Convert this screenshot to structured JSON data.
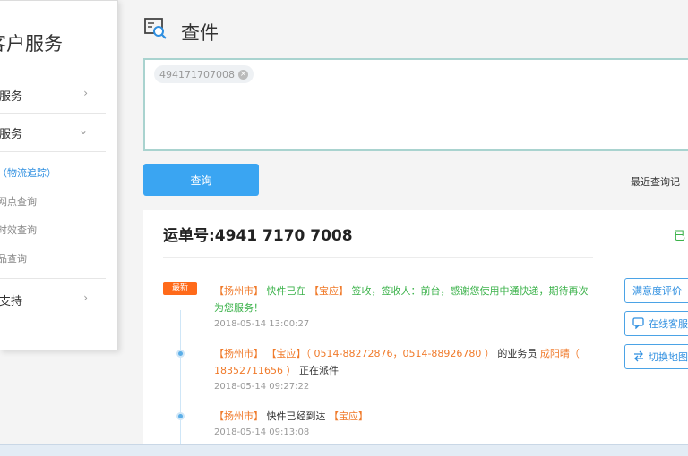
{
  "sidebar": {
    "title": "客户服务",
    "items": [
      {
        "label": "件服务",
        "chevron": "›"
      },
      {
        "label": "询服务",
        "chevron": "⌄"
      }
    ],
    "sub_items": [
      {
        "label": "件（物流追踪）",
        "active": true
      },
      {
        "label": "务网点查询"
      },
      {
        "label": "费时效查询"
      },
      {
        "label": "禁品查询"
      }
    ],
    "support": {
      "label": "服支持",
      "chevron": "›"
    }
  },
  "header": {
    "title": "查件",
    "icon": "search-document-icon"
  },
  "input": {
    "tag_value": "494171707008",
    "tag_close": "×"
  },
  "query": {
    "button_label": "查询",
    "recent_label": "最近查询记"
  },
  "result": {
    "waybill": "运单号:4941 7170 7008",
    "status": "已",
    "newest_badge": "最新",
    "events": [
      {
        "parts": [
          {
            "t": "【扬州市】",
            "c": "o"
          },
          {
            "t": " 快件已在 ",
            "c": "g"
          },
          {
            "t": "【宝应】",
            "c": "o"
          },
          {
            "t": " 签收，签收人：前台，感谢您使用中通快递，期待再次为您服务！",
            "c": "g"
          }
        ],
        "time": "2018-05-14 13:00:27"
      },
      {
        "parts": [
          {
            "t": "【扬州市】",
            "c": "o"
          },
          {
            "t": " ",
            "c": ""
          },
          {
            "t": "【宝应】",
            "c": "o"
          },
          {
            "t": "（ 0514-88272876，0514-88926780 ）",
            "c": "o"
          },
          {
            "t": " 的业务员 ",
            "c": ""
          },
          {
            "t": "成阳晴（ 18352711656 ）",
            "c": "o"
          },
          {
            "t": " 正在派件",
            "c": ""
          }
        ],
        "time": "2018-05-14 09:27:22"
      },
      {
        "parts": [
          {
            "t": "【扬州市】",
            "c": "o"
          },
          {
            "t": " 快件已经到达 ",
            "c": ""
          },
          {
            "t": "【宝应】",
            "c": "o"
          }
        ],
        "time": "2018-05-14 09:13:08"
      }
    ],
    "side_buttons": [
      {
        "label": "满意度评价",
        "icon": ""
      },
      {
        "label": "在线客服",
        "icon": "chat-icon"
      },
      {
        "label": "切换地图",
        "icon": "switch-arrows-icon"
      }
    ]
  },
  "colors": {
    "accent": "#3aa5f2",
    "orange": "#f07a2a",
    "green": "#3bb24a",
    "badge": "#ff6a1a"
  }
}
